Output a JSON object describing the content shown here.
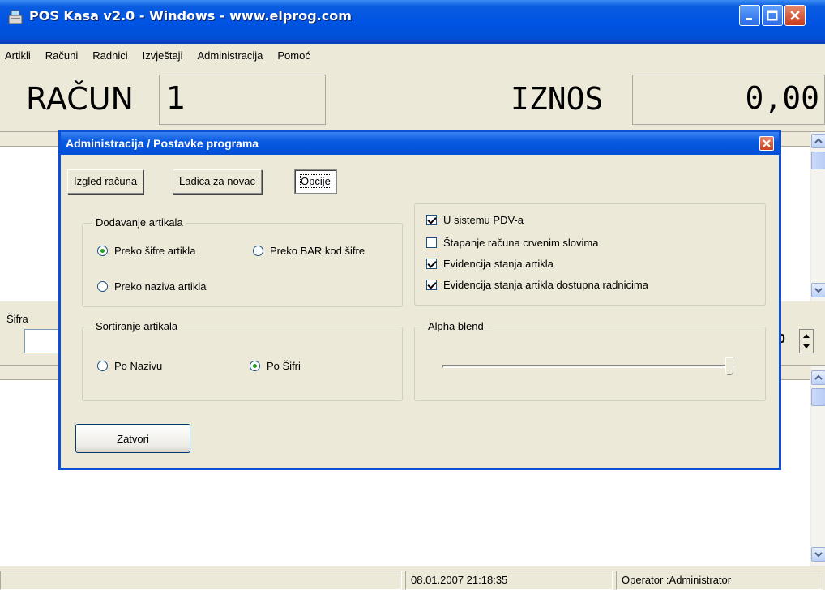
{
  "window": {
    "title": "POS Kasa v2.0 - Windows - www.elprog.com"
  },
  "menu": {
    "items": [
      {
        "label": "Artikli"
      },
      {
        "label": "Računi"
      },
      {
        "label": "Radnici"
      },
      {
        "label": "Izvještaji"
      },
      {
        "label": "Administracija"
      },
      {
        "label": "Pomoć"
      }
    ]
  },
  "header": {
    "racun_label": "RAČUN",
    "racun_value": "1",
    "iznos_label": "IZNOS",
    "iznos_value": "0,00"
  },
  "input_strip": {
    "sifra_label": "Šifra",
    "quantity_fragment": "0"
  },
  "statusbar": {
    "datetime": "08.01.2007 21:18:35",
    "operator": "Operator :Administrator"
  },
  "dialog": {
    "title": "Administracija / Postavke programa",
    "tabs": [
      {
        "label": "Izgled računa"
      },
      {
        "label": "Ladica za novac"
      },
      {
        "label": "Opcije"
      }
    ],
    "active_tab": "Opcije",
    "dodavanje": {
      "legend": "Dodavanje artikala",
      "options": [
        {
          "label": "Preko šifre artikla",
          "checked": true
        },
        {
          "label": "Preko BAR kod šifre",
          "checked": false
        },
        {
          "label": "Preko naziva artikla",
          "checked": false
        }
      ]
    },
    "sortiranje": {
      "legend": "Sortiranje artikala",
      "options": [
        {
          "label": "Po Nazivu",
          "checked": false
        },
        {
          "label": "Po Šifri",
          "checked": true
        }
      ]
    },
    "checkboxes": [
      {
        "label": "U sistemu PDV-a",
        "checked": true
      },
      {
        "label": "Štapanje računa crvenim slovima",
        "checked": false
      },
      {
        "label": "Evidencija stanja artikla",
        "checked": true
      },
      {
        "label": "Evidencija stanja artikla dostupna radnicima",
        "checked": true
      }
    ],
    "alpha_blend": {
      "legend": "Alpha blend",
      "level": 1.0
    },
    "close_button": "Zatvori"
  },
  "colors": {
    "titlebar_blue": "#0054E3",
    "face": "#ECE9D8",
    "close_red": "#C83A1A"
  }
}
